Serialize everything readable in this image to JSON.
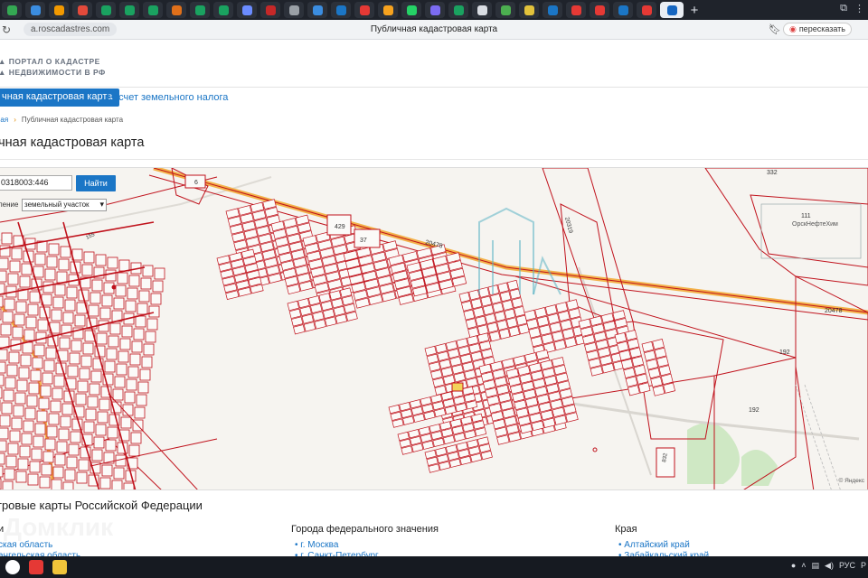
{
  "browser": {
    "tab_icon_colors": [
      "#34a853",
      "#3b8de0",
      "#f29900",
      "#e34a3b",
      "#1aa260",
      "#1aa260",
      "#1aa260",
      "#e0701a",
      "#1aa260",
      "#1aa260",
      "#6b8cff",
      "#c62828",
      "#9aa0a6",
      "#3b8de0",
      "#1b76c6",
      "#e53935",
      "#f6a21e",
      "#25d366",
      "#7c6cf2",
      "#1aa260",
      "#d9dde3",
      "#4caf50",
      "#e2c23b",
      "#1b76c6",
      "#e53935",
      "#e53935",
      "#1b76c6",
      "#e53935",
      "#1565c0"
    ],
    "new_tab_symbol": "+",
    "url": "a.roscadastres.com",
    "page_title": "Публичная кадастровая карта",
    "translate_label": "пересказать"
  },
  "portal": {
    "logo_line1": "ПОРТАЛ О КАДАСТРЕ",
    "logo_line2": "НЕДВИЖИМОСТИ В РФ",
    "nav_active": "чная кадастровая карта",
    "nav_link": "Расчет земельного налога",
    "breadcrumb_home": "ная",
    "breadcrumb_current": "Публичная кадастровая карта",
    "heading": "ичная кадастровая карта"
  },
  "map": {
    "search_value": "0318003:446",
    "find_button": "Найти",
    "layer_label": "ление",
    "layer_value": "земельный участок",
    "labels": {
      "road1": "20478",
      "road2": "20478",
      "road3": "20319",
      "n332": "332",
      "n111": "111",
      "company": "ОрскНефтеХим",
      "n192a": "192",
      "n192b": "192",
      "n429": "429",
      "n37": "37",
      "n6": "6",
      "n155": "155",
      "n832": "832"
    },
    "attribution": "© Яндекс"
  },
  "footer": {
    "heading": "тровые карты Российской Федерации",
    "col1_head": "и",
    "col1_links": [
      "ская область",
      "ангельская область"
    ],
    "col2_head": "Города федерального значения",
    "col2_links": [
      "г. Москва",
      "г. Санкт-Петербург"
    ],
    "col3_head": "Края",
    "col3_links": [
      "Алтайский край",
      "Забайкальский край"
    ],
    "watermark": "Домклик"
  },
  "taskbar": {
    "tray_lang": "РУС",
    "tray_extra": "Р"
  },
  "colors": {
    "accent": "#1b76c6",
    "parcel": "#c0121c",
    "road": "#f3b24a"
  }
}
